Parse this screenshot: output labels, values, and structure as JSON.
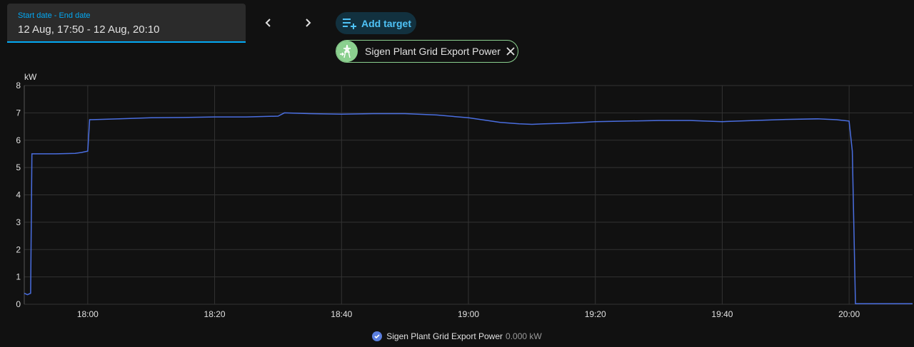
{
  "date_picker": {
    "label": "Start date - End date",
    "value": "12 Aug, 17:50 - 12 Aug, 20:10"
  },
  "nav": {
    "prev_icon": "chevron-left-icon",
    "next_icon": "chevron-right-icon"
  },
  "add_target": {
    "label": "Add target",
    "icon": "playlist-plus-icon"
  },
  "target_chip": {
    "label": "Sigen Plant Grid Export Power",
    "icon": "transmission-tower-export-icon",
    "close_icon": "close-icon"
  },
  "legend": {
    "name": "Sigen Plant Grid Export Power",
    "value": "0.000 kW"
  },
  "colors": {
    "accent": "#03a9f4",
    "series": "#4a6ee0",
    "chip": "#8bd08f"
  },
  "chart_data": {
    "type": "line",
    "ylabel": "kW",
    "ylim": [
      0,
      8
    ],
    "y_ticks": [
      0,
      1,
      2,
      3,
      4,
      5,
      6,
      7,
      8
    ],
    "xlim": [
      "17:50",
      "20:10"
    ],
    "x_ticks": [
      "18:00",
      "18:20",
      "18:40",
      "19:00",
      "19:20",
      "19:40",
      "20:00"
    ],
    "grid": true,
    "series": [
      {
        "name": "Sigen Plant Grid Export Power",
        "points": [
          [
            "17:50",
            0.4
          ],
          [
            "17:50.5",
            0.35
          ],
          [
            "17:51",
            0.4
          ],
          [
            "17:51.2",
            5.5
          ],
          [
            "17:53",
            5.5
          ],
          [
            "17:55",
            5.5
          ],
          [
            "17:58",
            5.52
          ],
          [
            "17:59",
            5.55
          ],
          [
            "18:00",
            5.6
          ],
          [
            "18:00.3",
            6.75
          ],
          [
            "18:05",
            6.78
          ],
          [
            "18:10",
            6.82
          ],
          [
            "18:15",
            6.83
          ],
          [
            "18:20",
            6.85
          ],
          [
            "18:25",
            6.85
          ],
          [
            "18:30",
            6.88
          ],
          [
            "18:31",
            7.0
          ],
          [
            "18:35",
            6.97
          ],
          [
            "18:40",
            6.95
          ],
          [
            "18:45",
            6.97
          ],
          [
            "18:50",
            6.97
          ],
          [
            "18:55",
            6.92
          ],
          [
            "19:00",
            6.82
          ],
          [
            "19:03",
            6.72
          ],
          [
            "19:05",
            6.65
          ],
          [
            "19:08",
            6.6
          ],
          [
            "19:10",
            6.58
          ],
          [
            "19:12",
            6.6
          ],
          [
            "19:15",
            6.62
          ],
          [
            "19:18",
            6.65
          ],
          [
            "19:20",
            6.68
          ],
          [
            "19:25",
            6.7
          ],
          [
            "19:30",
            6.72
          ],
          [
            "19:35",
            6.72
          ],
          [
            "19:40",
            6.68
          ],
          [
            "19:45",
            6.72
          ],
          [
            "19:50",
            6.76
          ],
          [
            "19:55",
            6.78
          ],
          [
            "19:58",
            6.75
          ],
          [
            "20:00",
            6.7
          ],
          [
            "20:00.5",
            5.6
          ],
          [
            "20:01",
            0.02
          ],
          [
            "20:05",
            0.02
          ],
          [
            "20:10",
            0.02
          ]
        ]
      }
    ]
  }
}
